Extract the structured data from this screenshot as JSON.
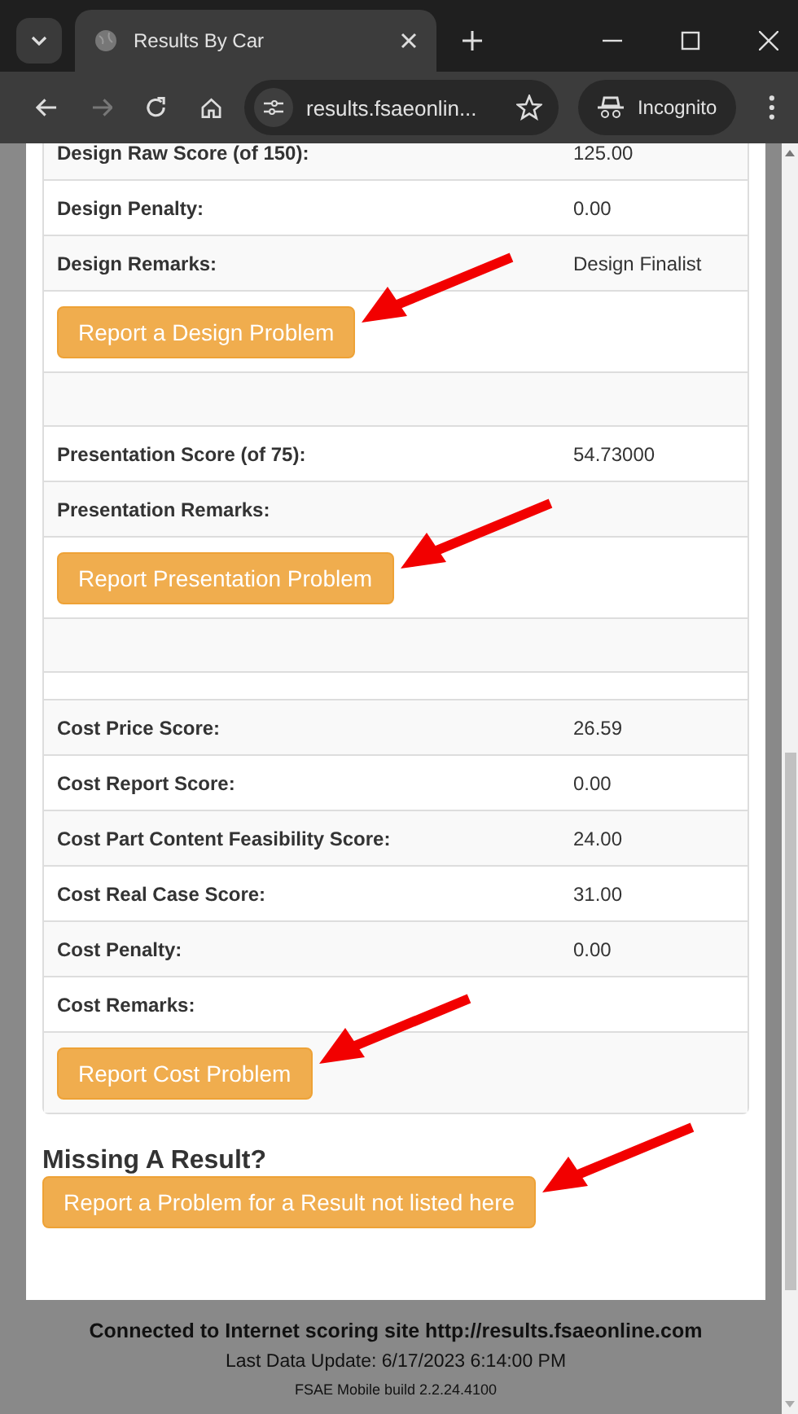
{
  "browser": {
    "tab_title": "Results By Car",
    "url": "results.fsaeonlin...",
    "profile": "Incognito"
  },
  "rows": [
    {
      "kind": "field",
      "label": "Design Raw Score (of 150):",
      "value": "125.00"
    },
    {
      "kind": "field",
      "label": "Design Penalty:",
      "value": "0.00"
    },
    {
      "kind": "field",
      "label": "Design Remarks:",
      "value": "Design Finalist"
    },
    {
      "kind": "button",
      "label": "Report a Design Problem"
    },
    {
      "kind": "blank"
    },
    {
      "kind": "field",
      "label": "Presentation Score (of 75):",
      "value": "54.73000"
    },
    {
      "kind": "field",
      "label": "Presentation Remarks:"
    },
    {
      "kind": "button",
      "label": "Report Presentation Problem"
    },
    {
      "kind": "blank"
    },
    {
      "kind": "spacer"
    },
    {
      "kind": "field",
      "label": "Cost Price Score:",
      "value": "26.59"
    },
    {
      "kind": "field",
      "label": "Cost Report Score:",
      "value": "0.00"
    },
    {
      "kind": "field",
      "label": "Cost Part Content Feasibility Score:",
      "value": "24.00"
    },
    {
      "kind": "field",
      "label": "Cost Real Case Score:",
      "value": "31.00"
    },
    {
      "kind": "field",
      "label": "Cost Penalty:",
      "value": "0.00"
    },
    {
      "kind": "field",
      "label": "Cost Remarks:"
    },
    {
      "kind": "button",
      "label": "Report Cost Problem"
    }
  ],
  "missing": {
    "heading": "Missing A Result?",
    "button": "Report a Problem for a Result not listed here"
  },
  "footer": {
    "connection": "Connected to Internet scoring site http://results.fsaeonline.com",
    "last_update": "Last Data Update: 6/17/2023 6:14:00 PM",
    "build": "FSAE Mobile build 2.2.24.4100"
  }
}
